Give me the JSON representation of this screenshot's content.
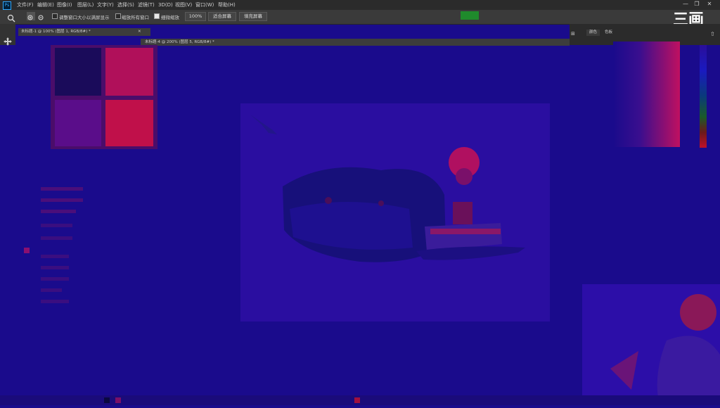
{
  "menubar": {
    "app_icon": "Ps",
    "items": [
      "文件(F)",
      "编辑(E)",
      "图像(I)",
      "图层(L)",
      "文字(Y)",
      "选择(S)",
      "滤镜(T)",
      "3D(D)",
      "视图(V)",
      "窗口(W)",
      "帮助(H)"
    ],
    "window_controls": [
      "—",
      "❐",
      "✕"
    ]
  },
  "options_bar": {
    "resize_windows_label": "调整窗口大小以满屏显示",
    "zoom_all_windows_label": "缩放所有窗口",
    "scrubby_zoom_label": "细微缩放",
    "zoom_value": "100%",
    "fit_screen_label": "适合屏幕",
    "fill_screen_label": "填充屏幕",
    "resize_windows_checked": false,
    "zoom_all_checked": false,
    "scrubby_checked": true
  },
  "documents": {
    "doc1_title": "未标题-1 @ 100% (图层 1, RGB/8#) *",
    "doc4_title": "未标题-4 @ 200% (图层 5, RGB/8#) *"
  },
  "panels": {
    "color_tab": "颜色",
    "swatches_tab": "色板"
  },
  "branding": {
    "logo_text": "三画"
  },
  "colors": {
    "canvas_bg": "#1a0b8c",
    "accent_red": "#c0102a",
    "badge_green": "#1f8a2c"
  }
}
